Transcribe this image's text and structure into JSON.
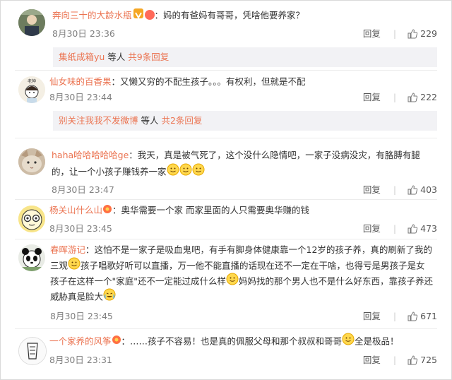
{
  "comments": [
    {
      "name": "奔向三十的大龄水瓶",
      "badge_text": "V",
      "text": "：妈的有爸妈有哥哥，凭啥他要养家？",
      "time": "8月30日 23:36",
      "reply": "回复",
      "likes": "229",
      "sub": {
        "name": "集纸成箱yu",
        "mid": " 等人 ",
        "more": "共9条回复"
      }
    },
    {
      "name": "仙女味的百香果",
      "text": "：又懒又穷的不配生孩子。。。有权利，但就是不配",
      "time": "8月30日 23:44",
      "reply": "回复",
      "likes": "222",
      "sub": {
        "name": "别关注我我不发微博",
        "mid": " 等人 ",
        "more": "共2条回复"
      }
    },
    {
      "name": "haha哈哈哈哈哈ge",
      "text_line1": "：我天，真是被气死了，这个没什么隐情吧，一家子没病没灾，有胳膊有腿",
      "text_line2": "的，让一个小孩子赚钱养一家",
      "time": "8月30日 23:47",
      "reply": "回复",
      "likes": "403"
    },
    {
      "name": "杨关山什么山",
      "text": "：奥华需要一个家 而家里面的人只需要奥华赚的钱",
      "time": "8月30日 23:45",
      "reply": "回复",
      "likes": "473"
    },
    {
      "name": "春晖游记",
      "text_line1": "：这怕不是一家子是吸血鬼吧，有手有脚身体健康靠一个12岁的孩子养，真的刷新了我的",
      "text_line2a": "三观",
      "text_line2b": "孩子唱歌好听可以直播，万一他不能直播的话现在还不一定在干啥，也得亏是男孩子是女",
      "text_line3a": "孩子在这样一个\"家庭\"还不一定能过成什么样",
      "text_line3b": "妈妈找的那个男人也不是什么好东西，靠孩子养还",
      "text_line4": "威胁真是脸大",
      "time": "8月30日 23:45",
      "reply": "回复",
      "likes": "671"
    },
    {
      "name": "一个家养的风筝",
      "text_a": "：……孩子不容易！也是真的佩服父母和那个叔叔和哥哥",
      "text_b": "全是极品！",
      "time": "8月30日 23:31",
      "reply": "回复",
      "likes": "725"
    }
  ],
  "icons": {
    "like": "thumbs-up-icon",
    "emoji": "smile-emoji-icon"
  },
  "colors": {
    "name": "#eb7350",
    "meta": "#808080",
    "subbox_bg": "#f2f2f5"
  }
}
